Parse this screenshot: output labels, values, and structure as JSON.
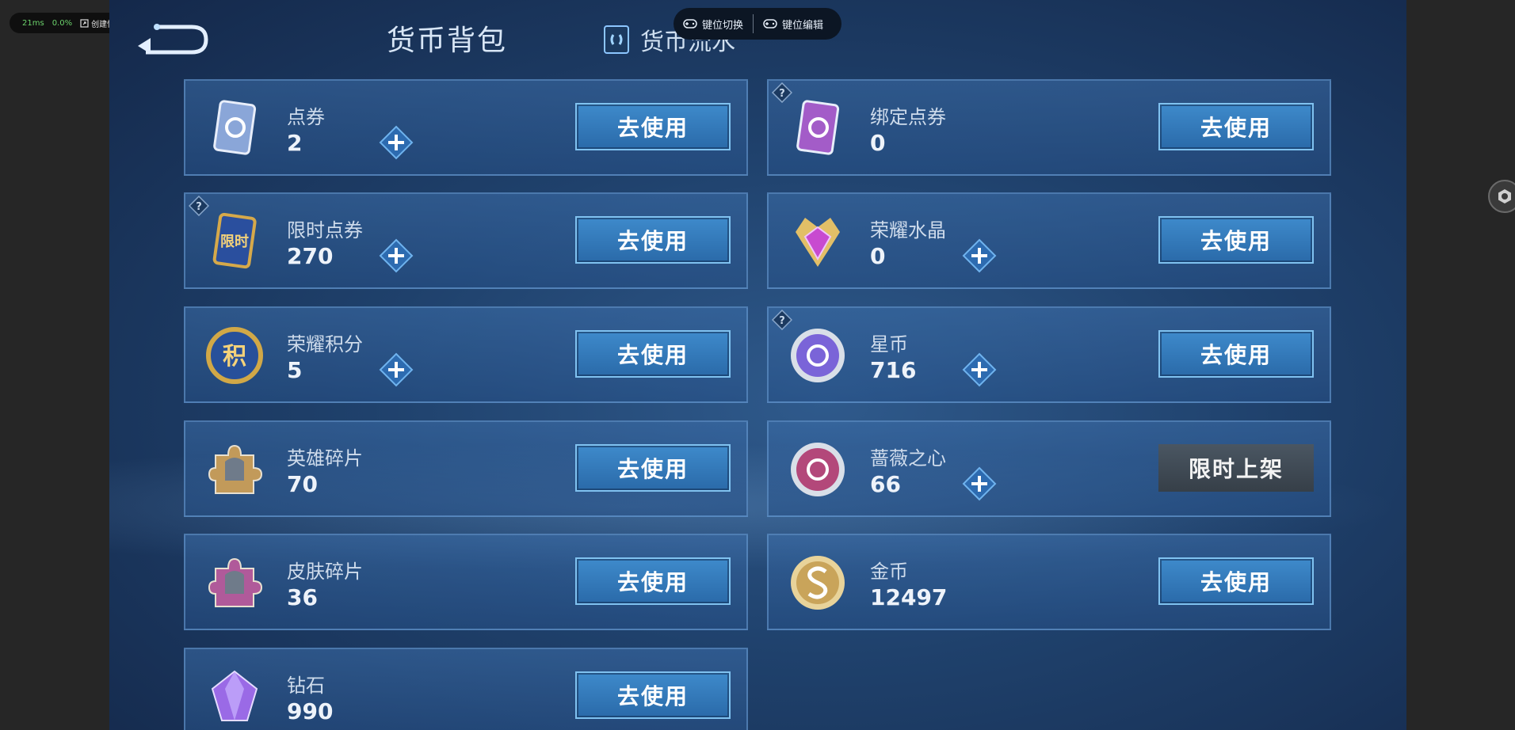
{
  "perf_bar": {
    "latency": "21ms",
    "loss": "0.0%",
    "shortcut_label": "创建快捷方式"
  },
  "overlay": {
    "key_switch": "键位切换",
    "key_edit": "键位编辑"
  },
  "header": {
    "active_tab": "货币背包",
    "flow_tab": "货币流水"
  },
  "button_label": "去使用",
  "limited_label": "限时上架",
  "items": [
    {
      "name": "点券",
      "count": "2",
      "icon": "ticket-card-icon",
      "color": "#8aa6d8"
    },
    {
      "name": "绑定点券",
      "count": "0",
      "icon": "bound-ticket-icon",
      "color": "#a35cc8"
    },
    {
      "name": "限时点券",
      "count": "270",
      "icon": "limited-ticket-icon",
      "color": "#d6a94a"
    },
    {
      "name": "荣耀水晶",
      "count": "0",
      "icon": "glory-crystal-icon",
      "color": "#c84ad0"
    },
    {
      "name": "荣耀积分",
      "count": "5",
      "icon": "glory-points-icon",
      "color": "#d1a847"
    },
    {
      "name": "星币",
      "count": "716",
      "icon": "star-coin-icon",
      "color": "#7a64d8"
    },
    {
      "name": "英雄碎片",
      "count": "70",
      "icon": "hero-fragment-icon",
      "color": "#c29a5a"
    },
    {
      "name": "蔷薇之心",
      "count": "66",
      "icon": "rose-heart-icon",
      "color": "#b3487a"
    },
    {
      "name": "皮肤碎片",
      "count": "36",
      "icon": "skin-fragment-icon",
      "color": "#b05a9a"
    },
    {
      "name": "金币",
      "count": "12497",
      "icon": "gold-coin-icon",
      "color": "#c9a45a"
    },
    {
      "name": "钻石",
      "count": "990",
      "icon": "diamond-icon",
      "color": "#9a6ae6"
    }
  ],
  "icon_glyphs": {
    "limited": "限时",
    "points": "积"
  }
}
